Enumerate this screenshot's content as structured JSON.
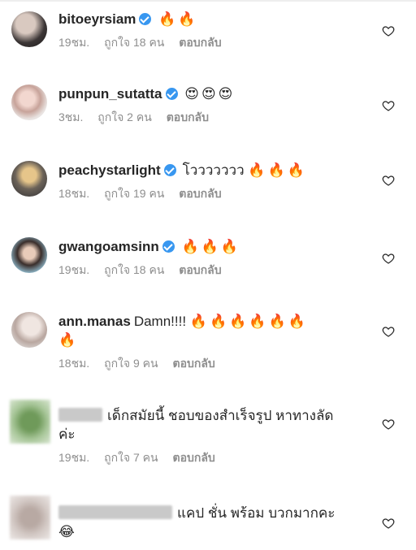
{
  "comments": [
    {
      "username": "bitoeyrsiam",
      "verified": true,
      "text": "",
      "emoji": "🔥🔥",
      "time": "19ชม.",
      "likes": "ถูกใจ 18 คน",
      "reply": "ตอบกลับ"
    },
    {
      "username": "punpun_sutatta",
      "verified": true,
      "text": "",
      "emoji": "😍😍😍",
      "time": "3ชม.",
      "likes": "ถูกใจ 2 คน",
      "reply": "ตอบกลับ"
    },
    {
      "username": "peachystarlight",
      "verified": true,
      "text": "โววววววว",
      "emoji": "🔥🔥🔥",
      "time": "18ชม.",
      "likes": "ถูกใจ 19 คน",
      "reply": "ตอบกลับ"
    },
    {
      "username": "gwangoamsinn",
      "verified": true,
      "text": "",
      "emoji": "🔥🔥🔥",
      "time": "19ชม.",
      "likes": "ถูกใจ 18 คน",
      "reply": "ตอบกลับ"
    },
    {
      "username": "ann.manas",
      "verified": false,
      "text": "Damn!!!!",
      "emoji": "🔥🔥🔥🔥🔥🔥",
      "emoji2": "🔥",
      "time": "18ชม.",
      "likes": "ถูกใจ 9 คน",
      "reply": "ตอบกลับ"
    },
    {
      "username": "",
      "verified": false,
      "text": "เด็กสมัยนี้ ชอบของสำเร็จรูป หาทางลัด",
      "text2": "ค่ะ",
      "emoji": "",
      "time": "19ชม.",
      "likes": "ถูกใจ 7 คน",
      "reply": "ตอบกลับ"
    },
    {
      "username": "",
      "verified": false,
      "text": "แคป ชั่น พร้อม บวกมากคะ",
      "emoji": "😂",
      "time": "",
      "likes": "",
      "reply": ""
    }
  ],
  "icons": {
    "heart": "heart-outline-icon",
    "verified": "verified-badge-icon"
  },
  "colors": {
    "verified": "#3897f0",
    "meta": "#8e8e8e",
    "text": "#262626"
  }
}
